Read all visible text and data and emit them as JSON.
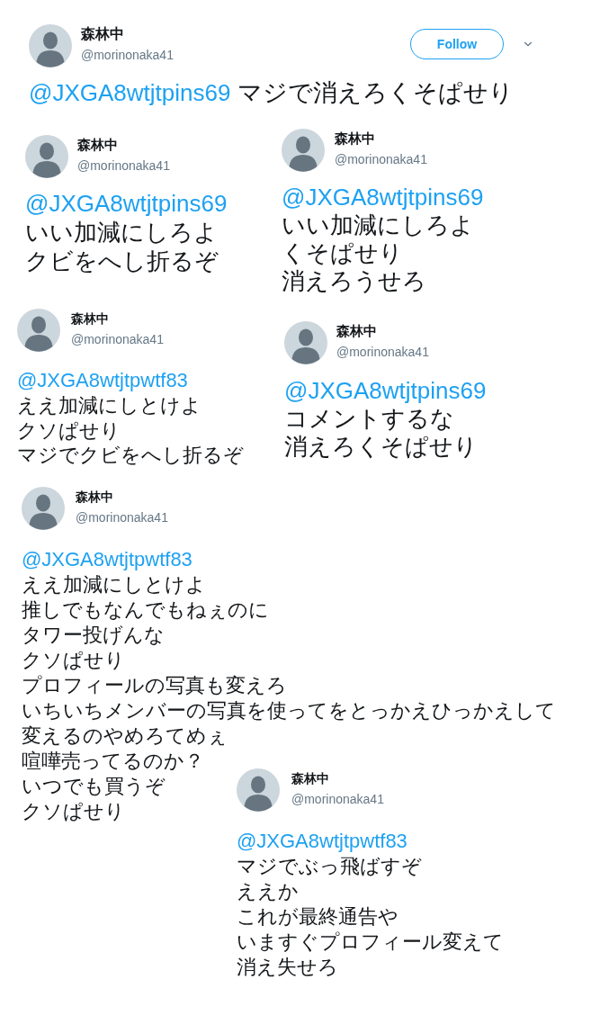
{
  "tweets": [
    {
      "kind": "main",
      "author": {
        "name": "森林中",
        "handle": "@morinonaka41"
      },
      "follow_button": "Follow",
      "mention": "@JXGA8wtjtpins69",
      "lines": [
        "マジで消えろくそぱせり"
      ]
    },
    {
      "kind": "clip",
      "author": {
        "name": "森林中",
        "handle": "@morinonaka41"
      },
      "mention": "@JXGA8wtjtpins69",
      "lines": [
        "いい加減にしろよ",
        "クビをへし折るぞ"
      ]
    },
    {
      "kind": "clip",
      "author": {
        "name": "森林中",
        "handle": "@morinonaka41"
      },
      "mention": "@JXGA8wtjtpins69",
      "lines": [
        "いい加減にしろよ",
        "くそぱせり",
        "消えろうせろ"
      ]
    },
    {
      "kind": "clip",
      "author": {
        "name": "森林中",
        "handle": "@morinonaka41"
      },
      "mention": "@JXGA8wtjtpwtf83",
      "lines": [
        "ええ加減にしとけよ",
        "クソぱせり",
        "マジでクビをへし折るぞ"
      ]
    },
    {
      "kind": "clip",
      "author": {
        "name": "森林中",
        "handle": "@morinonaka41"
      },
      "mention": "@JXGA8wtjtpins69",
      "lines": [
        "コメントするな",
        "消えろくそぱせり"
      ]
    },
    {
      "kind": "clip",
      "author": {
        "name": "森林中",
        "handle": "@morinonaka41"
      },
      "mention": "@JXGA8wtjtpwtf83",
      "lines": [
        "ええ加減にしとけよ",
        "推しでもなんでもねぇのに",
        "タワー投げんな",
        "クソぱせり",
        "プロフィールの写真も変えろ",
        "いちいちメンバーの写真を使ってをとっかえひっかえして",
        "変えるのやめろてめぇ",
        "喧嘩売ってるのか？",
        "いつでも買うぞ",
        "クソぱせり"
      ]
    },
    {
      "kind": "clip",
      "author": {
        "name": "森林中",
        "handle": "@morinonaka41"
      },
      "mention": "@JXGA8wtjtpwtf83",
      "lines": [
        "マジでぶっ飛ばすぞ",
        "ええか",
        "これが最終通告や",
        "いますぐプロフィール変えて",
        "消え失せろ"
      ]
    }
  ]
}
